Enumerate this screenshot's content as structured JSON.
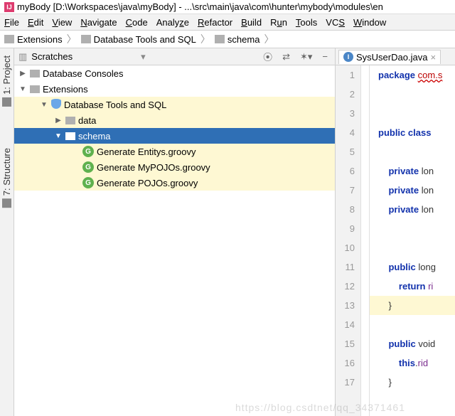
{
  "title": "myBody [D:\\Workspaces\\java\\myBody] - ...\\src\\main\\java\\com\\hunter\\mybody\\modules\\en",
  "menu": [
    "File",
    "Edit",
    "View",
    "Navigate",
    "Code",
    "Analyze",
    "Refactor",
    "Build",
    "Run",
    "Tools",
    "VCS",
    "Window"
  ],
  "breadcrumb": [
    "Extensions",
    "Database Tools and SQL",
    "schema"
  ],
  "side_tabs": {
    "project": "1: Project",
    "structure": "7: Structure"
  },
  "tree": {
    "header": "Scratches",
    "root1": "Database Consoles",
    "root2": "Extensions",
    "db_tools": "Database Tools and SQL",
    "data": "data",
    "schema": "schema",
    "g1": "Generate Entitys.groovy",
    "g2": "Generate MyPOJOs.groovy",
    "g3": "Generate POJOs.groovy"
  },
  "toolbar": {
    "target": "⦿",
    "sep": "⇄",
    "gear": "✶",
    "minus": "−"
  },
  "editor": {
    "tab": "SysUserDao.java",
    "lines": {
      "l1": "package com.s",
      "l4": "public class ",
      "l6": "    private lon",
      "l7": "    private lon",
      "l8": "    private lon",
      "l11": "    public long",
      "l12": "        return ri",
      "l13": "    }",
      "l15": "    public void",
      "l16": "        this.rid",
      "l17": "    }"
    }
  },
  "watermark": "https://blog.csdtnet/qq_34371461"
}
